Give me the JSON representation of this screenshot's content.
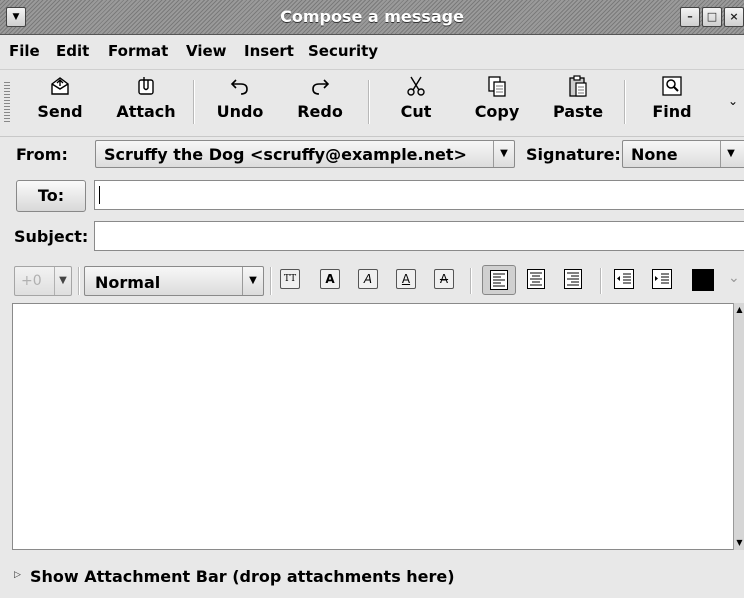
{
  "window": {
    "title": "Compose a message"
  },
  "menu": [
    "File",
    "Edit",
    "Format",
    "View",
    "Insert",
    "Security"
  ],
  "toolbar": {
    "send": "Send",
    "attach": "Attach",
    "undo": "Undo",
    "redo": "Redo",
    "cut": "Cut",
    "copy": "Copy",
    "paste": "Paste",
    "find": "Find"
  },
  "from": {
    "label": "From:",
    "value": "Scruffy the Dog <scruffy@example.net>"
  },
  "signature": {
    "label": "Signature:",
    "value": "None"
  },
  "to": {
    "button": "To:",
    "value": ""
  },
  "subject": {
    "label": "Subject:",
    "value": ""
  },
  "format": {
    "size": "+0",
    "paragraph": "Normal",
    "text_color": "#000000"
  },
  "attachment_bar": {
    "label": "Show Attachment Bar (drop attachments here)"
  }
}
